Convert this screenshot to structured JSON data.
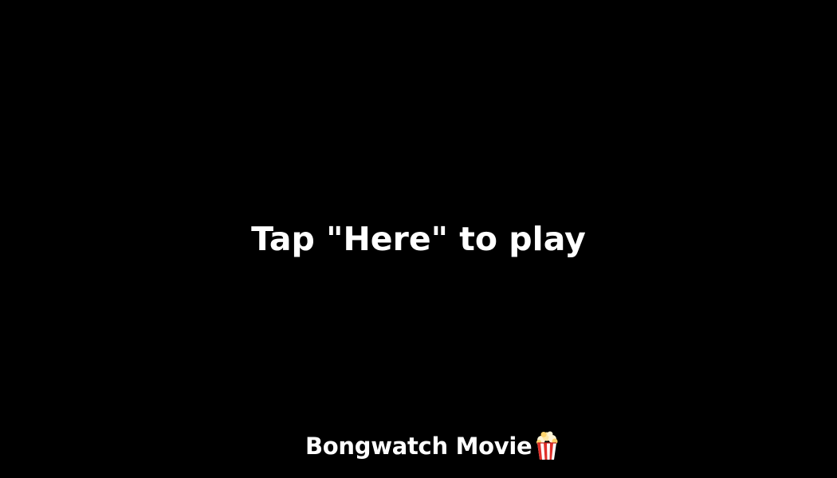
{
  "play_prompt": {
    "text": "Tap \"Here\" to play"
  },
  "brand": {
    "name": "Bongwatch Movie",
    "icon": "popcorn-icon"
  },
  "colors": {
    "background": "#000000",
    "text": "#ffffff",
    "popcorn_stripe": "#e0302a"
  }
}
